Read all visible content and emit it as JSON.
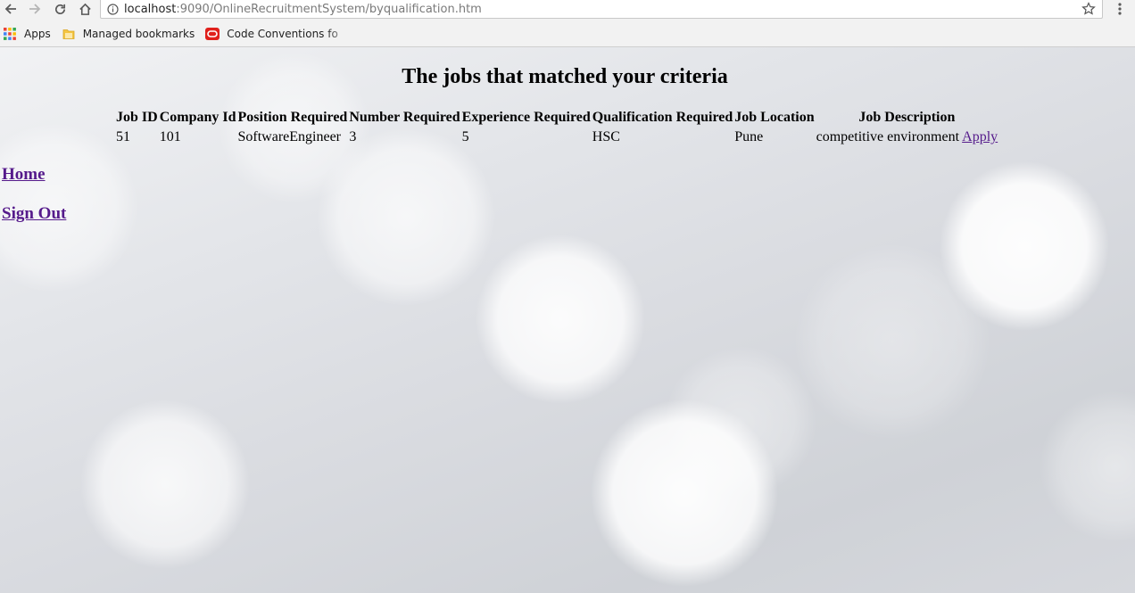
{
  "browser": {
    "url_host": "localhost",
    "url_rest": ":9090/OnlineRecruitmentSystem/byqualification.htm",
    "bookmarks": [
      {
        "label": "Apps",
        "icon": "apps-grid-icon"
      },
      {
        "label": "Managed bookmarks",
        "icon": "folder-icon"
      },
      {
        "label": "Code Conventions fo",
        "icon": "oracle-icon"
      }
    ]
  },
  "page": {
    "heading": "The jobs that matched your criteria",
    "table": {
      "headers": [
        "Job ID",
        "Company Id",
        "Position Required",
        "Number Required",
        "Experience Required",
        "Qualification Required",
        "Job Location",
        "Job Description"
      ],
      "rows": [
        {
          "job_id": "51",
          "company_id": "101",
          "position": "SoftwareEngineer",
          "number": "3",
          "experience": "5",
          "qualification": "HSC",
          "location": "Pune",
          "description": "competitive environment",
          "apply_label": "Apply"
        }
      ]
    },
    "links": {
      "home": "Home",
      "sign_out": "Sign Out"
    }
  },
  "colors": {
    "visited_link": "#551a8b",
    "text": "#000000"
  }
}
